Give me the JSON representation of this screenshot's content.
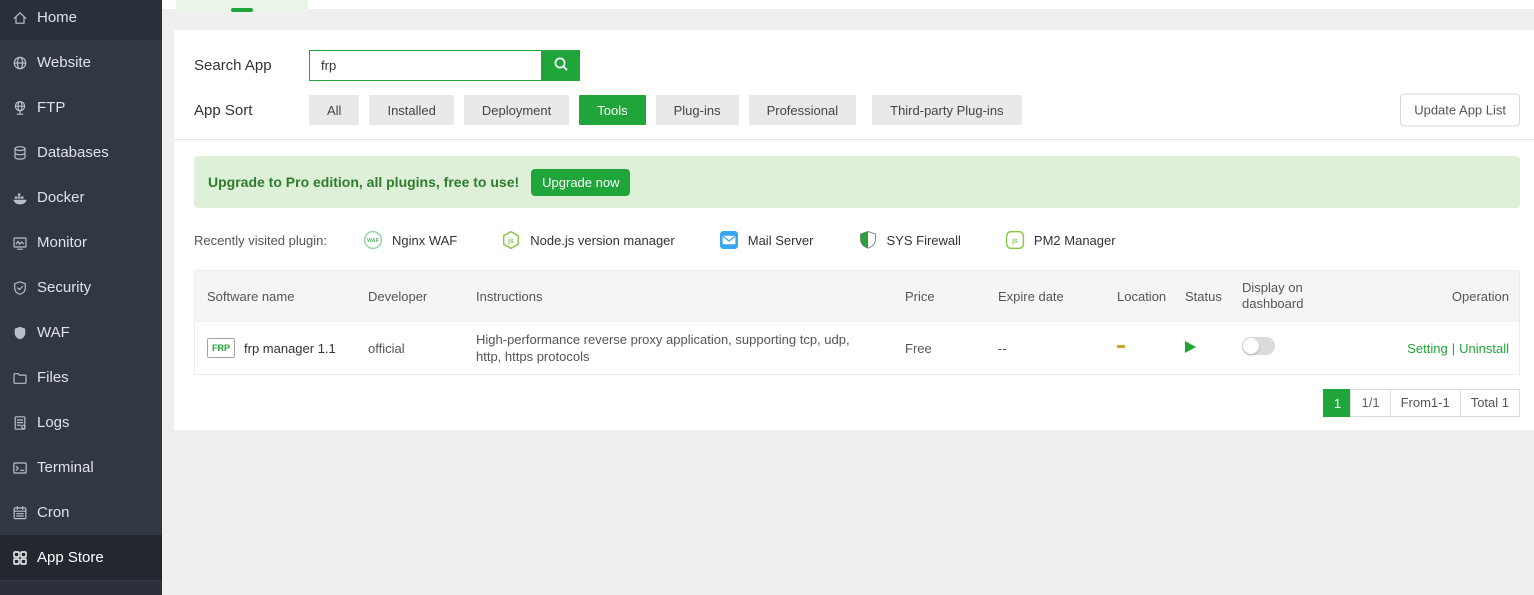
{
  "colors": {
    "primary": "#20a53a",
    "sidebar_bg": "#313743",
    "sidebar_active": "#23272f",
    "page_bg": "#efefef",
    "banner_bg": "#dff0d8",
    "banner_text": "#2d7d2d",
    "button_gray": "#e9e9e9",
    "table_header_bg": "#f5f5f5",
    "folder_yellow": "#dbb22c",
    "mail_blue": "#36a6f2",
    "node_green": "#8cc84b"
  },
  "sidebar": {
    "items": [
      {
        "label": "Home",
        "icon": "home-icon",
        "active": false
      },
      {
        "label": "Website",
        "icon": "website-icon",
        "active": false
      },
      {
        "label": "FTP",
        "icon": "ftp-icon",
        "active": false
      },
      {
        "label": "Databases",
        "icon": "databases-icon",
        "active": false
      },
      {
        "label": "Docker",
        "icon": "docker-icon",
        "active": false
      },
      {
        "label": "Monitor",
        "icon": "monitor-icon",
        "active": false
      },
      {
        "label": "Security",
        "icon": "security-icon",
        "active": false
      },
      {
        "label": "WAF",
        "icon": "waf-icon",
        "active": false
      },
      {
        "label": "Files",
        "icon": "files-icon",
        "active": false
      },
      {
        "label": "Logs",
        "icon": "logs-icon",
        "active": false
      },
      {
        "label": "Terminal",
        "icon": "terminal-icon",
        "active": false
      },
      {
        "label": "Cron",
        "icon": "cron-icon",
        "active": false
      },
      {
        "label": "App Store",
        "icon": "app-store-icon",
        "active": true
      }
    ]
  },
  "search": {
    "label": "Search App",
    "value": "frp",
    "icon": "search-icon"
  },
  "sort": {
    "label": "App Sort",
    "selected": "Tools",
    "options": [
      "All",
      "Installed",
      "Deployment",
      "Tools",
      "Plug-ins",
      "Professional",
      "Third-party Plug-ins"
    ]
  },
  "toolbar": {
    "update_app_list": "Update App List"
  },
  "banner": {
    "text": "Upgrade to Pro edition, all plugins, free to use!",
    "button": "Upgrade now"
  },
  "recent": {
    "label": "Recently visited plugin:",
    "plugins": [
      {
        "name": "Nginx WAF",
        "icon": "nginx-waf-icon",
        "badge": "WAF"
      },
      {
        "name": "Node.js version manager",
        "icon": "nodejs-icon",
        "badge": "js"
      },
      {
        "name": "Mail Server",
        "icon": "mail-icon"
      },
      {
        "name": "SYS Firewall",
        "icon": "sys-firewall-icon"
      },
      {
        "name": "PM2 Manager",
        "icon": "pm2-icon",
        "badge": "js"
      }
    ]
  },
  "table": {
    "columns": [
      "Software name",
      "Developer",
      "Instructions",
      "Price",
      "Expire date",
      "Location",
      "Status",
      "Display on dashboard",
      "Operation"
    ],
    "rows": [
      {
        "icon_text": "FRP",
        "name": "frp manager 1.1",
        "developer": "official",
        "instructions": "High-performance reverse proxy application, supporting tcp, udp, http, https protocols",
        "price": "Free",
        "expire_date": "--",
        "location_icon": "folder-icon",
        "status_icon": "play-icon",
        "display_on_dashboard": "off",
        "op_setting": "Setting",
        "op_sep": "|",
        "op_uninstall": "Uninstall"
      }
    ]
  },
  "pagination": {
    "current": "1",
    "page": "1/1",
    "range": "From1-1",
    "total": "Total 1"
  }
}
